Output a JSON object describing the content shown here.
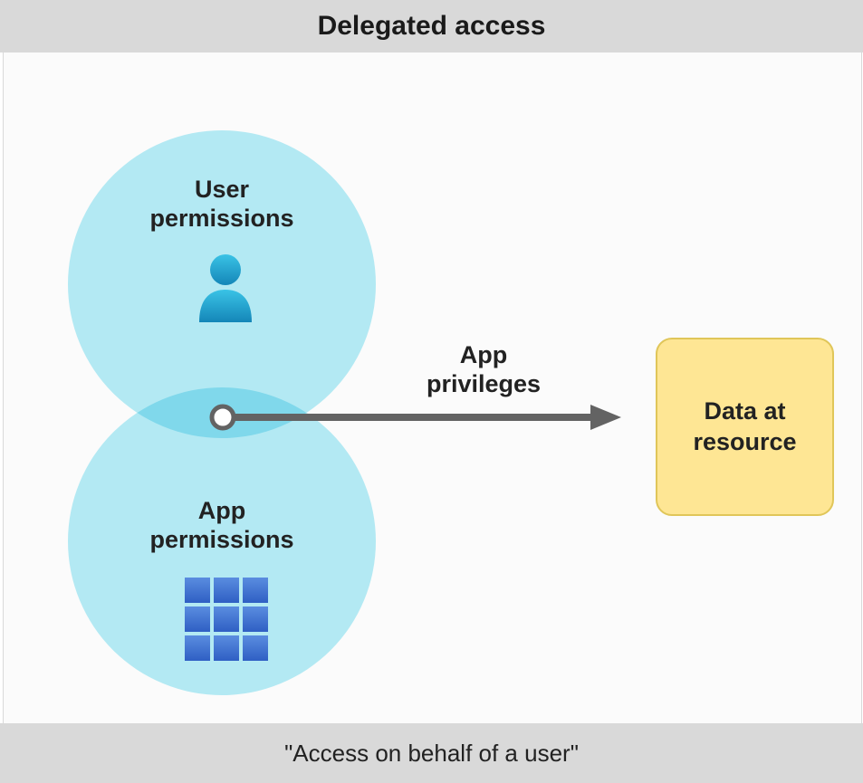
{
  "header": {
    "title": "Delegated access"
  },
  "footer": {
    "caption": "\"Access on behalf of a user\""
  },
  "venn": {
    "top": {
      "label": "User\npermissions"
    },
    "bottom": {
      "label": "App\npermissions"
    }
  },
  "arrow": {
    "label": "App\nprivileges"
  },
  "resource": {
    "label": "Data at\nresource"
  },
  "colors": {
    "vennFill": "#b6edf7",
    "resourceFill": "#fee694",
    "resourceBorder": "#e0c659",
    "bannerGray": "#d9d9d9",
    "arrowGray": "#636363"
  }
}
